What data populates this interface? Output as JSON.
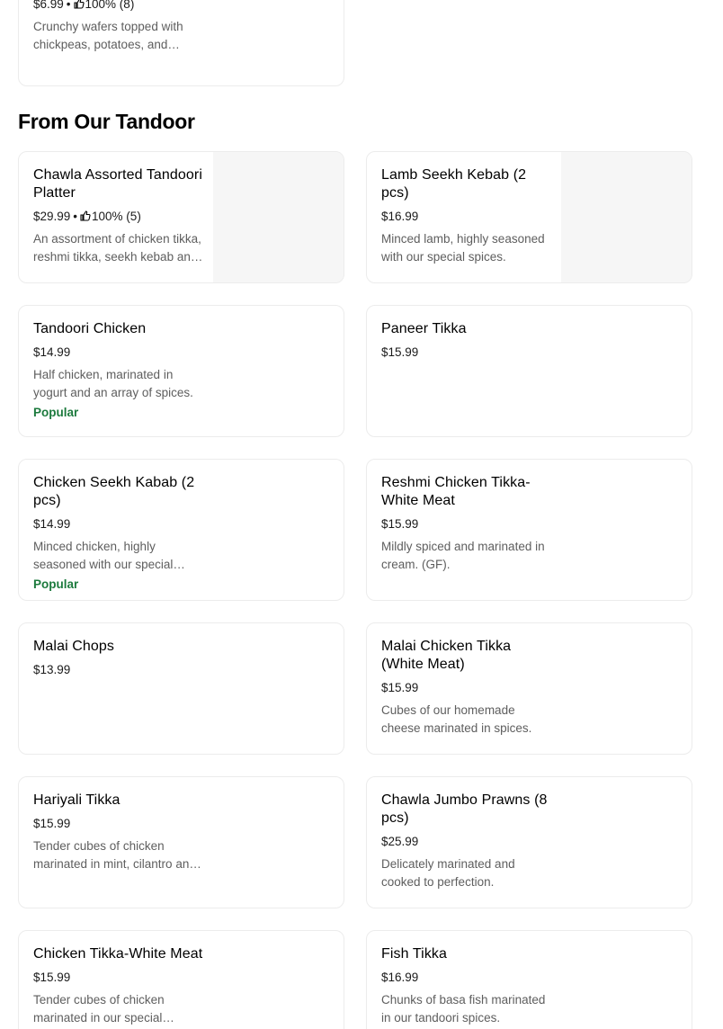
{
  "top_card": {
    "price": "$6.99",
    "rating": "100% (8)",
    "description": "Crunchy wafers topped with chickpeas, potatoes, and onions"
  },
  "section": {
    "title": "From Our Tandoor"
  },
  "items": [
    {
      "name": "Chawla Assorted Tandoori Platter",
      "price": "$29.99",
      "rating": "100% (5)",
      "description": "An assortment of chicken tikka, reshmi tikka, seekh kebab and tandoori chicken."
    },
    {
      "name": "Lamb Seekh Kebab (2 pcs)",
      "price": "$16.99",
      "description": "Minced lamb, highly seasoned with our special spices."
    },
    {
      "name": "Tandoori Chicken",
      "price": "$14.99",
      "description": "Half chicken, marinated in yogurt and an array of spices.",
      "badge": "Popular"
    },
    {
      "name": "Paneer Tikka",
      "price": "$15.99"
    },
    {
      "name": "Chicken Seekh Kabab (2 pcs)",
      "price": "$14.99",
      "description": "Minced chicken, highly seasoned with our special spices.",
      "badge": "Popular"
    },
    {
      "name": "Reshmi Chicken Tikka- White Meat",
      "price": "$15.99",
      "description": "Mildly spiced and marinated in cream. (GF)."
    },
    {
      "name": "Malai Chops",
      "price": "$13.99"
    },
    {
      "name": "Malai Chicken Tikka (White Meat)",
      "price": "$15.99",
      "description": "Cubes of our homemade cheese marinated in spices."
    },
    {
      "name": "Hariyali Tikka",
      "price": "$15.99",
      "description": "Tender cubes of chicken marinated in mint, cilantro and spices."
    },
    {
      "name": "Chawla Jumbo Prawns (8 pcs)",
      "price": "$25.99",
      "description": "Delicately marinated and cooked to perfection."
    },
    {
      "name": "Chicken Tikka-White Meat",
      "price": "$15.99",
      "description": "Tender cubes of chicken marinated in our special tandoori spices."
    },
    {
      "name": "Fish Tikka",
      "price": "$16.99",
      "description": "Chunks of basa fish marinated in our tandoori spices."
    }
  ]
}
